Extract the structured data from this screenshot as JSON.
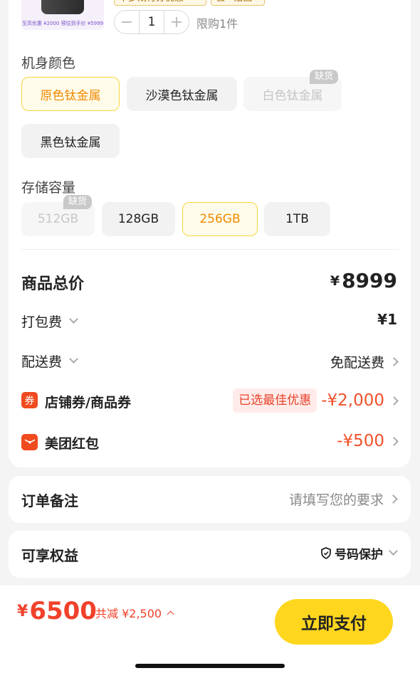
{
  "product": {
    "thumb_caption": "至高优惠 ¥2000   预估到手价 ¥5999",
    "tag_partial_left": "平多期付分优惠",
    "tag_partial_right": "极 · 赔画",
    "quantity": "1",
    "qty_minus": "−",
    "qty_plus": "+",
    "limit_text": "限购1件"
  },
  "color_section": {
    "label": "机身颜色",
    "options": [
      {
        "label": "原色钛金属",
        "state": "selected"
      },
      {
        "label": "沙漠色钛金属",
        "state": "normal"
      },
      {
        "label": "白色钛金属",
        "state": "disabled",
        "badge": "缺货"
      },
      {
        "label": "黑色钛金属",
        "state": "normal"
      }
    ]
  },
  "storage_section": {
    "label": "存储容量",
    "options": [
      {
        "label": "512GB",
        "state": "disabled",
        "badge": "缺货"
      },
      {
        "label": "128GB",
        "state": "normal"
      },
      {
        "label": "256GB",
        "state": "selected"
      },
      {
        "label": "1TB",
        "state": "normal"
      }
    ]
  },
  "summary": {
    "total_label": "商品总价",
    "total_currency": "¥",
    "total_value": "8999",
    "packing_label": "打包费",
    "packing_value": "¥1",
    "delivery_label": "配送费",
    "delivery_value": "免配送费",
    "coupon_icon": "券",
    "coupon_label": "店铺券/商品券",
    "coupon_tag": "已选最佳优惠",
    "coupon_value": "-¥2,000",
    "redpack_label": "美团红包",
    "redpack_value": "-¥500"
  },
  "remarks": {
    "label": "订单备注",
    "placeholder": "请填写您的要求"
  },
  "benefits": {
    "label": "可享权益",
    "value": "号码保护"
  },
  "footer": {
    "currency": "¥",
    "price": "6500",
    "savings": "共减 ¥2,500",
    "pay_button": "立即支付"
  },
  "colors": {
    "accent_yellow": "#ffd61e",
    "selected_text": "#f08a00",
    "price_red": "#f0412b"
  }
}
